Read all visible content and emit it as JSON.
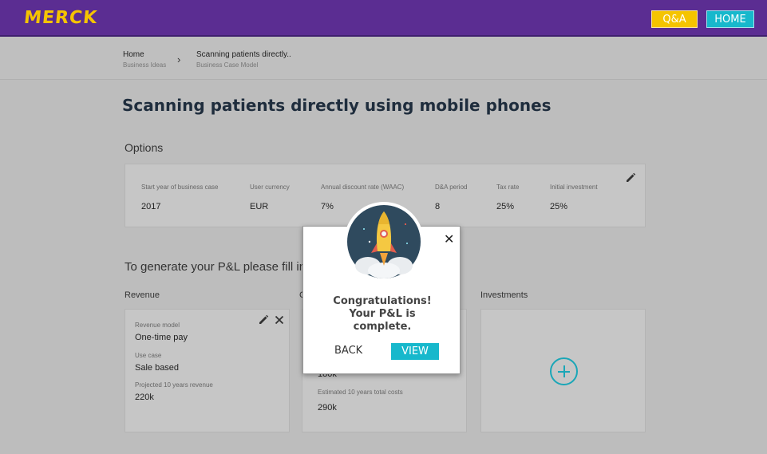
{
  "header": {
    "logo_text": "MERCK",
    "qa_label": "Q&A",
    "home_label": "HOME"
  },
  "breadcrumb": [
    {
      "title": "Home",
      "subtitle": "Business Ideas"
    },
    {
      "title": "Scanning patients directly..",
      "subtitle": "Business Case Model"
    }
  ],
  "page_title": "Scanning patients directly using mobile phones",
  "options": {
    "label": "Options",
    "fields": [
      {
        "label": "Start year of business case",
        "value": "2017"
      },
      {
        "label": "User currency",
        "value": "EUR"
      },
      {
        "label": "Annual discount rate (WAAC)",
        "value": "7%"
      },
      {
        "label": "D&A period",
        "value": "8"
      },
      {
        "label": "Tax rate",
        "value": "25%"
      },
      {
        "label": "Initial investment",
        "value": "25%"
      }
    ]
  },
  "generate_label": "To generate your P&L please fill in",
  "columns": {
    "revenue": "Revenue",
    "costs_partial": "C",
    "investments": "Investments"
  },
  "revenue": {
    "model_label": "Revenue model",
    "model_value": "One-time pay",
    "use_case_label": "Use case",
    "use_case_value": "Sale based",
    "projected_label": "Projected 10 years revenue",
    "projected_value": "220k"
  },
  "costs": {
    "partial_value": "180k",
    "total_label": "Estimated 10 years total costs",
    "total_value": "290k"
  },
  "modal": {
    "line1": "Congratulations!",
    "line2": "Your P&L is",
    "line3": "complete.",
    "back_label": "BACK",
    "view_label": "VIEW",
    "close_glyph": "✕"
  },
  "colors": {
    "header_purple": "#5b2d92",
    "brand_yellow": "#f5c400",
    "accent_teal": "#17b8cc",
    "overlay_grey": "#bdbdbd"
  }
}
